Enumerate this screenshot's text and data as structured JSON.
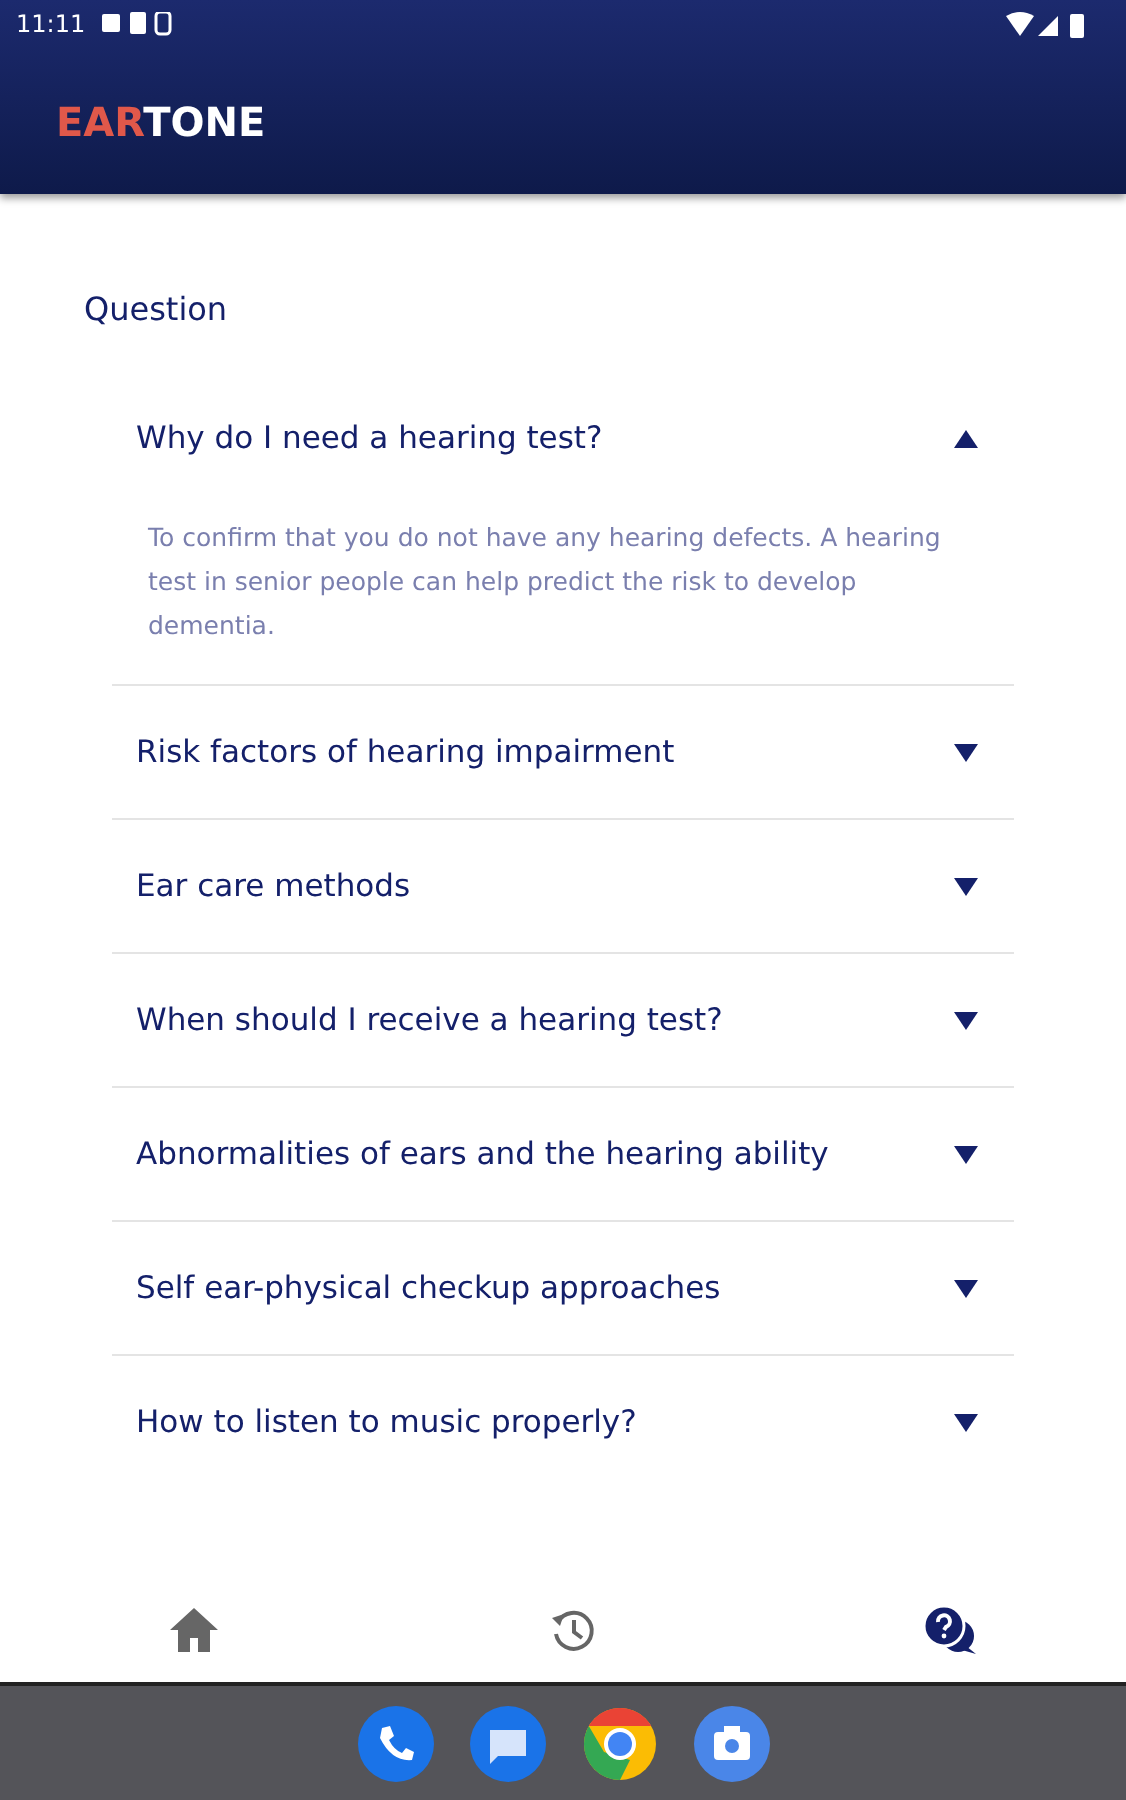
{
  "status_bar": {
    "time": "11:11"
  },
  "app_bar": {
    "logo_accent": "EAR",
    "logo_rest": "TONE"
  },
  "section_title": "Question",
  "faq": [
    {
      "question": "Why do I need a hearing test?",
      "expanded": true,
      "answer": "To confirm that you do not have any hearing defects. A hearing test in senior people can help predict the risk to develop dementia."
    },
    {
      "question": "Risk factors of hearing impairment",
      "expanded": false
    },
    {
      "question": "Ear care methods",
      "expanded": false
    },
    {
      "question": "When should I receive a hearing test?",
      "expanded": false
    },
    {
      "question": "Abnormalities of ears and the hearing ability",
      "expanded": false
    },
    {
      "question": "Self ear-physical checkup approaches",
      "expanded": false
    },
    {
      "question": "How to listen to music properly?",
      "expanded": false
    }
  ],
  "bottom_nav": [
    {
      "kind": "home",
      "selected": false
    },
    {
      "kind": "history",
      "selected": false
    },
    {
      "kind": "faq",
      "selected": true
    }
  ]
}
